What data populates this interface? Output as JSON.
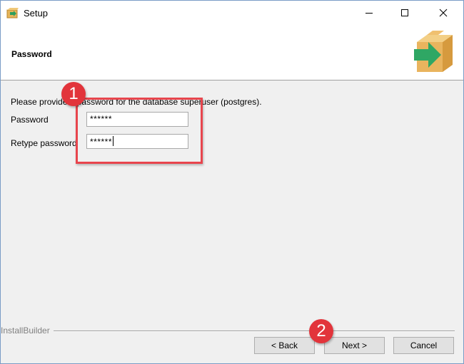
{
  "window": {
    "title": "Setup"
  },
  "header": {
    "title": "Password",
    "logo_icon": "box-arrow-icon"
  },
  "form": {
    "prompt": "Please provide a password for the database superuser (postgres).",
    "password_label": "Password",
    "password_value": "******",
    "retype_label": "Retype password",
    "retype_value": "******"
  },
  "annotations": {
    "badge1": "1",
    "badge2": "2",
    "color": "#e2343b"
  },
  "footer": {
    "brand": "InstallBuilder",
    "back_label": "< Back",
    "next_label": "Next >",
    "cancel_label": "Cancel"
  }
}
